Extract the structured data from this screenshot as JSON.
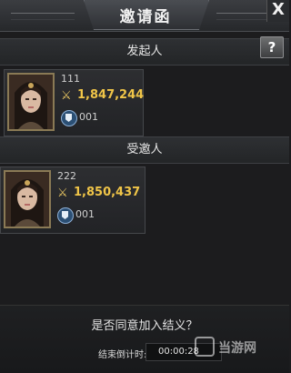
{
  "window": {
    "title": "邀请函",
    "close_glyph": "X"
  },
  "sections": {
    "initiator_label": "发起人",
    "invitee_label": "受邀人",
    "help_glyph": "?"
  },
  "initiator": {
    "name": "111",
    "power": "1,847,244",
    "guild": "001"
  },
  "invitee": {
    "name": "222",
    "power": "1,850,437",
    "guild": "001"
  },
  "prompt": {
    "question": "是否同意加入结义？",
    "countdown_label": "结束倒计时:",
    "countdown_value": "00:00:28"
  },
  "watermark": {
    "text": "当游网"
  },
  "icons": {
    "power": "crossed-swords-icon",
    "guild": "guild-banner-icon"
  },
  "colors": {
    "power_text": "#f0c548",
    "accent_gold": "#8a7a55"
  }
}
